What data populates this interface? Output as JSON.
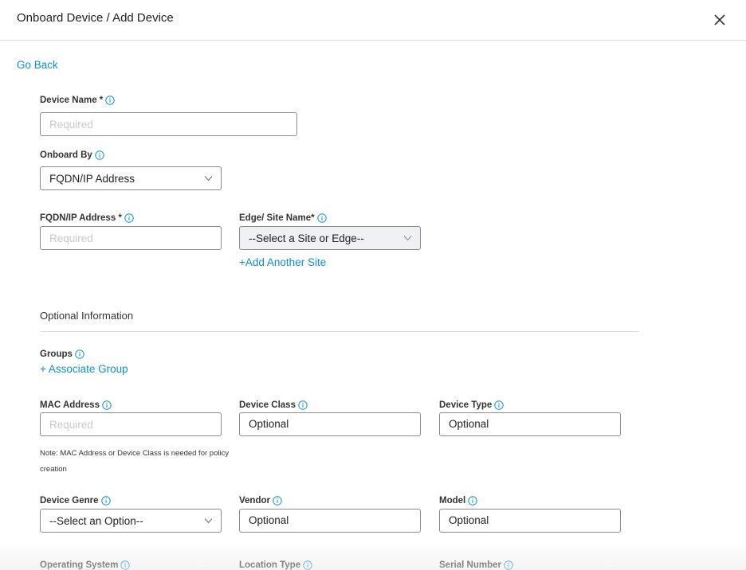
{
  "header": {
    "title": "Onboard Device / Add Device",
    "close_icon": "close-icon"
  },
  "nav": {
    "go_back": "Go Back"
  },
  "form": {
    "device_name": {
      "label": "Device Name *",
      "placeholder": "Required"
    },
    "onboard_by": {
      "label": "Onboard By",
      "value": "FQDN/IP Address"
    },
    "fqdn": {
      "label": "FQDN/IP Address *",
      "placeholder": "Required"
    },
    "site": {
      "label": "Edge/ Site Name*",
      "value": "--Select a Site or Edge--"
    },
    "add_site": "+Add Another Site"
  },
  "optional": {
    "title": "Optional Information",
    "groups": {
      "label": "Groups",
      "link": "+ Associate Group"
    },
    "mac": {
      "label": "MAC Address",
      "placeholder": "Required"
    },
    "device_class": {
      "label": "Device Class",
      "placeholder": "Optional"
    },
    "device_type": {
      "label": "Device Type",
      "placeholder": "Optional"
    },
    "note": "Note: MAC Address or Device Class is needed for policy creation",
    "device_genre": {
      "label": "Device Genre",
      "value": "--Select an Option--"
    },
    "vendor": {
      "label": "Vendor",
      "placeholder": "Optional"
    },
    "model": {
      "label": "Model",
      "placeholder": "Optional"
    },
    "operating_system": {
      "label": "Operating System"
    },
    "location_type": {
      "label": "Location Type"
    },
    "serial_number": {
      "label": "Serial Number"
    }
  },
  "colors": {
    "link": "#0b8fd4",
    "border": "#8a8a8a",
    "placeholder": "#c9c9c9",
    "select_grey": "#eef0f4"
  }
}
